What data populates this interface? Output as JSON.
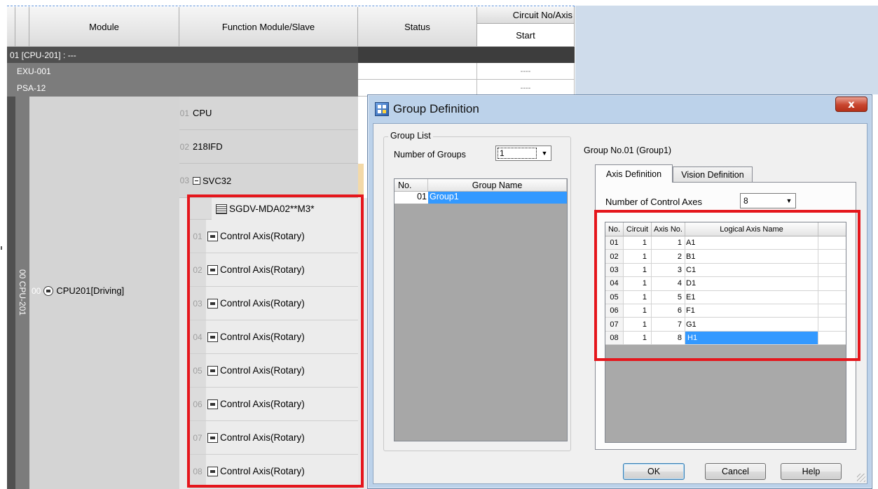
{
  "grid": {
    "headers": {
      "module": "Module",
      "function_module": "Function Module/Slave",
      "status": "Status",
      "circuit_no": "Circuit No/Axis",
      "start": "Start"
    },
    "rack_row": "01 [CPU-201] : ---",
    "units": [
      {
        "name": "EXU-001",
        "start": "----"
      },
      {
        "name": "PSA-12",
        "start": "----"
      }
    ],
    "cpu_vertical_label": "00 CPU-201",
    "cpu_num": "00",
    "cpu_name": "CPU201[Driving]",
    "function_modules": [
      {
        "num": "01",
        "name": "CPU"
      },
      {
        "num": "02",
        "name": "218IFD"
      },
      {
        "num": "03",
        "name": "SVC32"
      }
    ],
    "slave_device": "SGDV-MDA02**M3*",
    "axes": [
      {
        "num": "01",
        "label": "Control Axis(Rotary)"
      },
      {
        "num": "02",
        "label": "Control Axis(Rotary)"
      },
      {
        "num": "03",
        "label": "Control Axis(Rotary)"
      },
      {
        "num": "04",
        "label": "Control Axis(Rotary)"
      },
      {
        "num": "05",
        "label": "Control Axis(Rotary)"
      },
      {
        "num": "06",
        "label": "Control Axis(Rotary)"
      },
      {
        "num": "07",
        "label": "Control Axis(Rotary)"
      },
      {
        "num": "08",
        "label": "Control Axis(Rotary)"
      }
    ]
  },
  "dialog": {
    "title": "Group Definition",
    "close_symbol": "x",
    "group_list": {
      "legend": "Group List",
      "number_of_groups_label": "Number of Groups",
      "number_of_groups_value": "1",
      "columns": [
        "No.",
        "Group Name"
      ],
      "rows": [
        {
          "no": "01",
          "name": "Group1"
        }
      ]
    },
    "group_heading": "Group No.01 (Group1)",
    "tabs": [
      {
        "label": "Axis Definition",
        "active": true
      },
      {
        "label": "Vision Definition",
        "active": false
      }
    ],
    "control_axes_label": "Number of Control Axes",
    "control_axes_value": "8",
    "axis_table": {
      "columns": [
        "No.",
        "Circuit",
        "Axis No.",
        "Logical Axis Name"
      ],
      "rows": [
        {
          "no": "01",
          "circuit": "1",
          "axis": "1",
          "name": "A1"
        },
        {
          "no": "02",
          "circuit": "1",
          "axis": "2",
          "name": "B1"
        },
        {
          "no": "03",
          "circuit": "1",
          "axis": "3",
          "name": "C1"
        },
        {
          "no": "04",
          "circuit": "1",
          "axis": "4",
          "name": "D1"
        },
        {
          "no": "05",
          "circuit": "1",
          "axis": "5",
          "name": "E1"
        },
        {
          "no": "06",
          "circuit": "1",
          "axis": "6",
          "name": "F1"
        },
        {
          "no": "07",
          "circuit": "1",
          "axis": "7",
          "name": "G1"
        },
        {
          "no": "08",
          "circuit": "1",
          "axis": "8",
          "name": "H1"
        }
      ]
    },
    "buttons": {
      "ok": "OK",
      "cancel": "Cancel",
      "help": "Help"
    }
  },
  "colors": {
    "highlight_box": "#e5161c",
    "selection": "#3399ff",
    "dialog_frame": "#bcd2ea"
  }
}
